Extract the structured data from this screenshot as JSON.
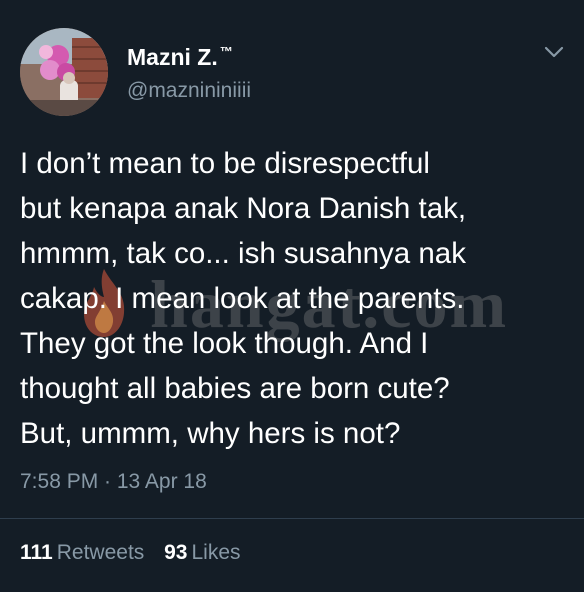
{
  "tweet": {
    "display_name": "Mazni Z.",
    "display_name_badge": "™",
    "handle": "@maznininiiii",
    "text_lines": [
      "I don’t mean to be disrespectful",
      "but kenapa anak Nora Danish tak,",
      "hmmm, tak co... ish susahnya nak",
      "cakap. I mean look at the parents.",
      "They got the look though. And I",
      "thought all babies are born cute?",
      "But, ummm, why hers is not?"
    ],
    "timestamp": "7:58 PM · 13 Apr 18",
    "retweets_count": "111",
    "retweets_label": "Retweets",
    "likes_count": "93",
    "likes_label": "Likes"
  },
  "watermark": {
    "text": "hangat.com",
    "icon": "flame-icon"
  },
  "icons": {
    "caret": "chevron-down-icon"
  },
  "colors": {
    "background": "#141d26",
    "primary_text": "#ffffff",
    "secondary_text": "#8899a6",
    "divider": "#2f3e4d"
  }
}
